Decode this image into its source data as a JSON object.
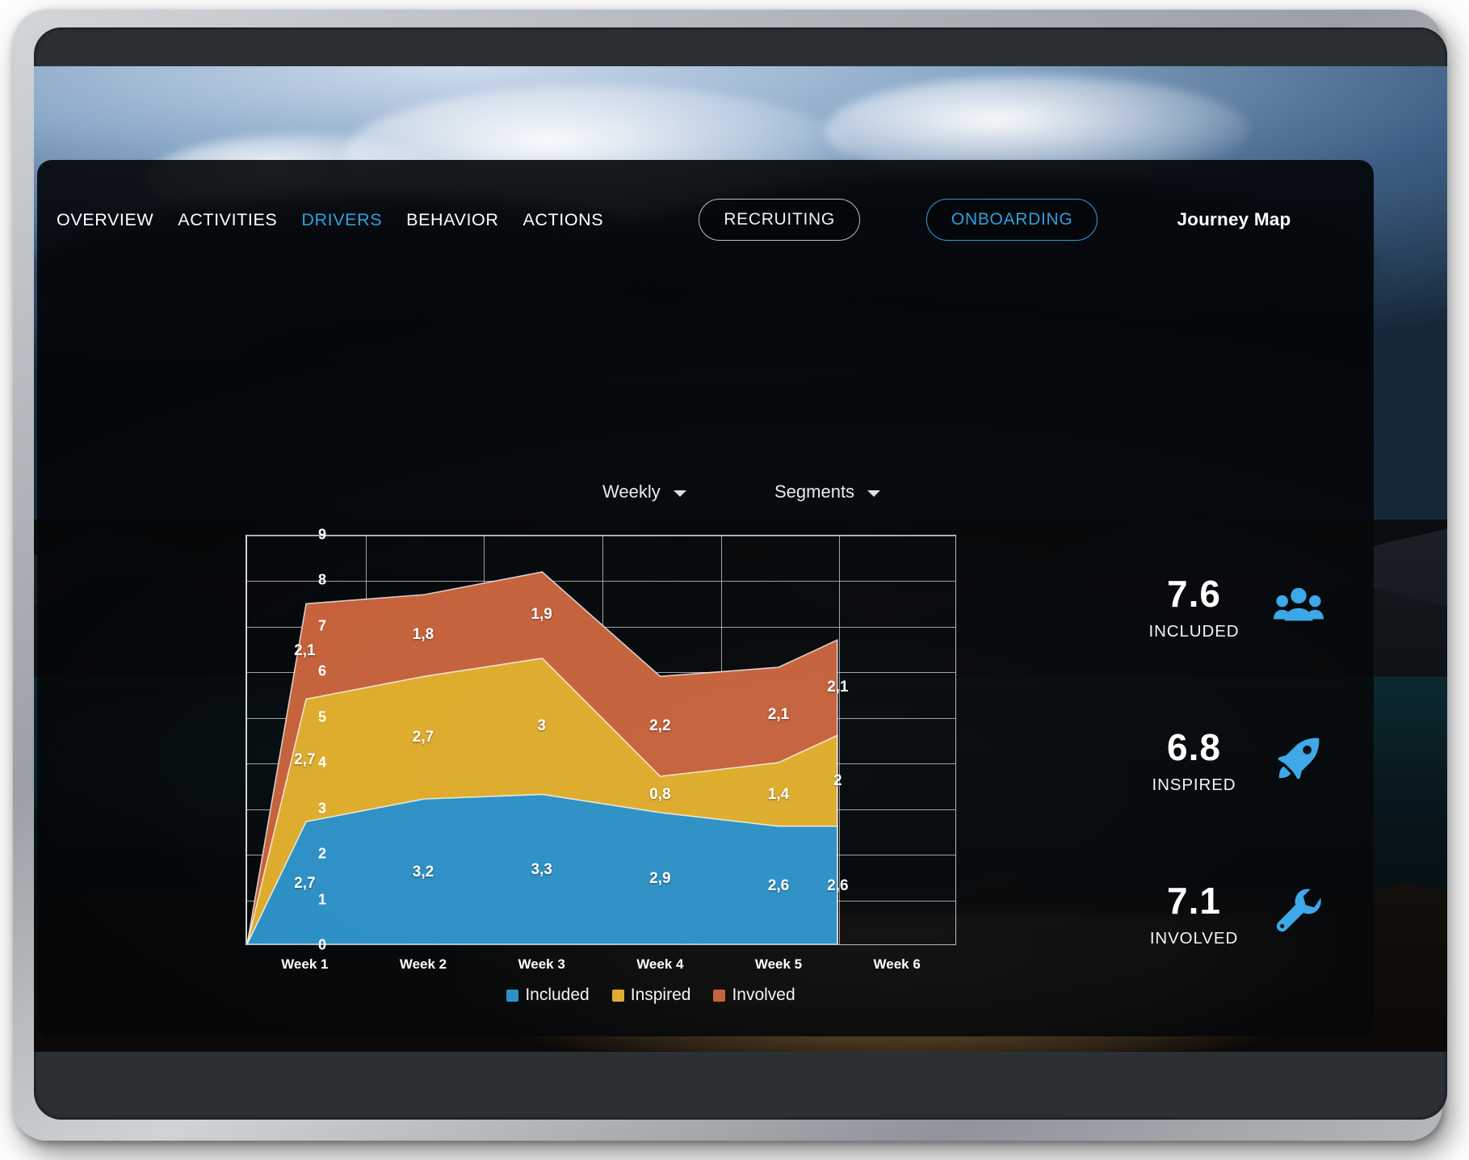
{
  "nav": {
    "items": [
      {
        "label": "OVERVIEW",
        "active": false
      },
      {
        "label": "ACTIVITIES",
        "active": false
      },
      {
        "label": "DRIVERS",
        "active": true
      },
      {
        "label": "BEHAVIOR",
        "active": false
      },
      {
        "label": "ACTIONS",
        "active": false
      }
    ],
    "mode_recruiting": "RECRUITING",
    "mode_onboarding": "ONBOARDING",
    "title": "Journey Map"
  },
  "filters": {
    "period": "Weekly",
    "segments": "Segments"
  },
  "colors": {
    "accent": "#2e9fe0",
    "included": "#2b8fc4",
    "inspired": "#ddab2a",
    "involved": "#c4603a",
    "panel": "#02040 7"
  },
  "chart_data": {
    "type": "area",
    "stacked": true,
    "title": "",
    "xlabel": "",
    "ylabel": "",
    "ylim": [
      0,
      9
    ],
    "yticks": [
      0,
      1,
      2,
      3,
      4,
      5,
      6,
      7,
      8,
      9
    ],
    "grid": true,
    "legend_position": "bottom",
    "categories": [
      "Week 1",
      "Week 2",
      "Week 3",
      "Week 4",
      "Week 5",
      "Week 6"
    ],
    "series": [
      {
        "name": "Included",
        "color": "#2b8fc4",
        "values": [
          2.7,
          3.2,
          3.3,
          2.9,
          2.6,
          2.6
        ],
        "labels": [
          "2,7",
          "3,2",
          "3,3",
          "2,9",
          "2,6",
          "2,6"
        ]
      },
      {
        "name": "Inspired",
        "color": "#ddab2a",
        "values": [
          2.7,
          2.7,
          3.0,
          0.8,
          1.4,
          2.0
        ],
        "labels": [
          "2,7",
          "2,7",
          "3",
          "0,8",
          "1,4",
          "2"
        ]
      },
      {
        "name": "Involved",
        "color": "#c4603a",
        "values": [
          2.1,
          1.8,
          1.9,
          2.2,
          2.1,
          2.1
        ],
        "labels": [
          "2,1",
          "1,8",
          "1,9",
          "2,2",
          "2,1",
          "2,1"
        ]
      }
    ],
    "totals": [
      7.5,
      7.7,
      8.2,
      5.9,
      6.1,
      6.7
    ]
  },
  "kpis": [
    {
      "value": "7.6",
      "label": "INCLUDED",
      "icon": "people-group-icon"
    },
    {
      "value": "6.8",
      "label": "INSPIRED",
      "icon": "rocket-icon"
    },
    {
      "value": "7.1",
      "label": "INVOLVED",
      "icon": "wrench-icon"
    }
  ]
}
